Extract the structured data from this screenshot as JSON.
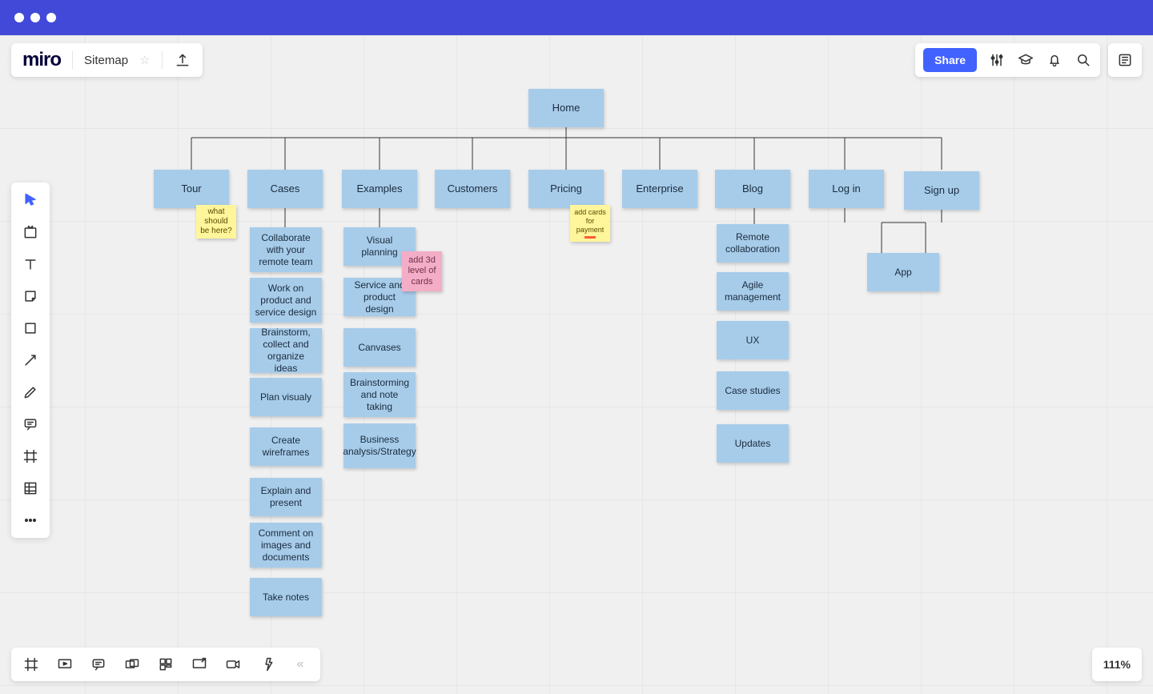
{
  "app": {
    "logo": "miro",
    "board_title": "Sitemap"
  },
  "share": {
    "label": "Share"
  },
  "zoom": {
    "value": "111%"
  },
  "sitemap": {
    "root": "Home",
    "top": [
      "Tour",
      "Cases",
      "Examples",
      "Customers",
      "Pricing",
      "Enterprise",
      "Blog",
      "Log in",
      "Sign up"
    ],
    "cases": [
      "Collaborate with your remote team",
      "Work on product and service design",
      "Brainstorm, collect and organize ideas",
      "Plan visualy",
      "Create wireframes",
      "Explain and present",
      "Comment on images and documents",
      "Take notes"
    ],
    "examples": [
      "Visual planning",
      "Service and product design",
      "Canvases",
      "Brainstorming and note taking",
      "Business analysis/Strategy"
    ],
    "blog": [
      "Remote collaboration",
      "Agile management",
      "UX",
      "Case studies",
      "Updates"
    ],
    "signup": [
      "App"
    ]
  },
  "notes": {
    "tour": "what should be here?",
    "pricing": "add cards for payment",
    "examples": "add 3d level of cards"
  }
}
